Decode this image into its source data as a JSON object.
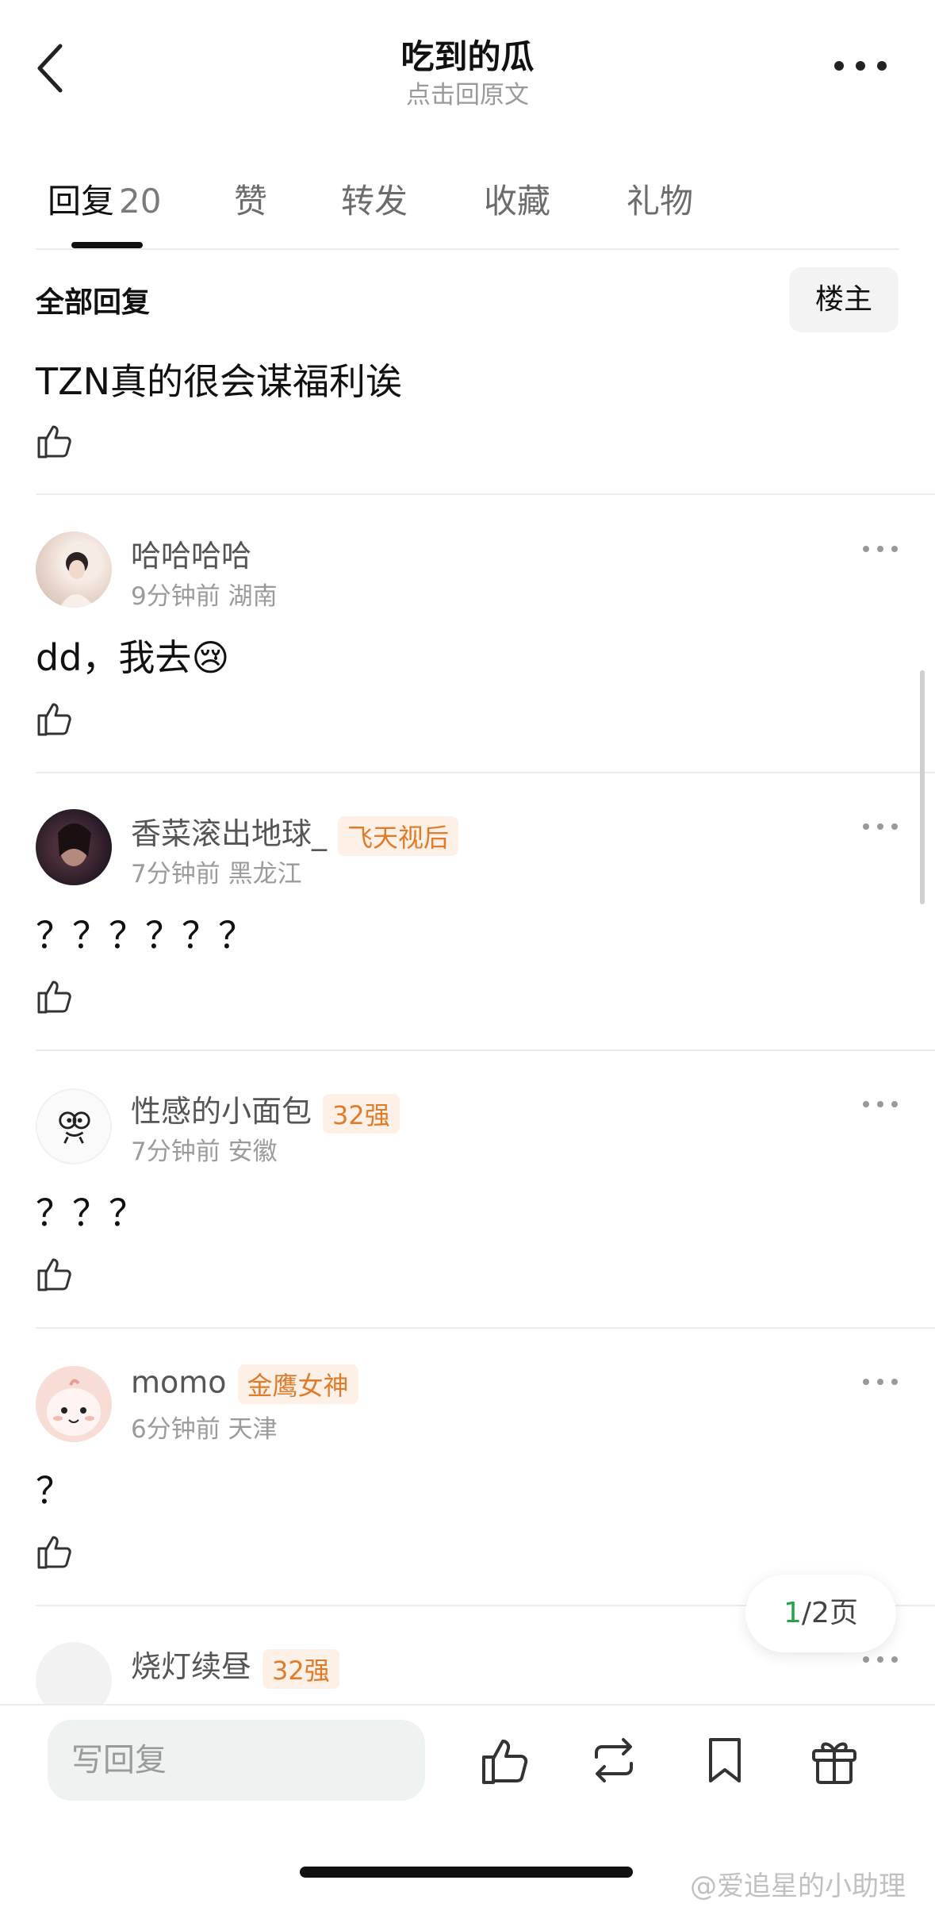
{
  "header": {
    "title": "吃到的瓜",
    "subtitle": "点击回原文"
  },
  "tabs": [
    {
      "label": "回复",
      "count": "20",
      "active": true
    },
    {
      "label": "赞"
    },
    {
      "label": "转发"
    },
    {
      "label": "收藏"
    },
    {
      "label": "礼物"
    }
  ],
  "replies_header": {
    "label": "全部回复",
    "op_button": "楼主"
  },
  "top_post": {
    "text": "TZN真的很会谋福利诶"
  },
  "comments": [
    {
      "username": "哈哈哈哈",
      "badge": "",
      "time": "9分钟前",
      "location": "湖南",
      "text": "dd，我去😢"
    },
    {
      "username": "香菜滚出地球_",
      "badge": "飞天视后",
      "time": "7分钟前",
      "location": "黑龙江",
      "text": "？？？？？？"
    },
    {
      "username": "性感的小面包",
      "badge": "32强",
      "time": "7分钟前",
      "location": "安徽",
      "text": "？？？"
    },
    {
      "username": "momo",
      "badge": "金鹰女神",
      "time": "6分钟前",
      "location": "天津",
      "text": "？"
    },
    {
      "username": "烧灯续昼",
      "badge": "32强"
    }
  ],
  "pagination": {
    "current": "1",
    "rest": "/2页"
  },
  "bottom_bar": {
    "reply_placeholder": "写回复",
    "icons": [
      "like-icon",
      "repost-icon",
      "bookmark-icon",
      "gift-icon"
    ]
  },
  "watermark": "@爱追星的小助理"
}
